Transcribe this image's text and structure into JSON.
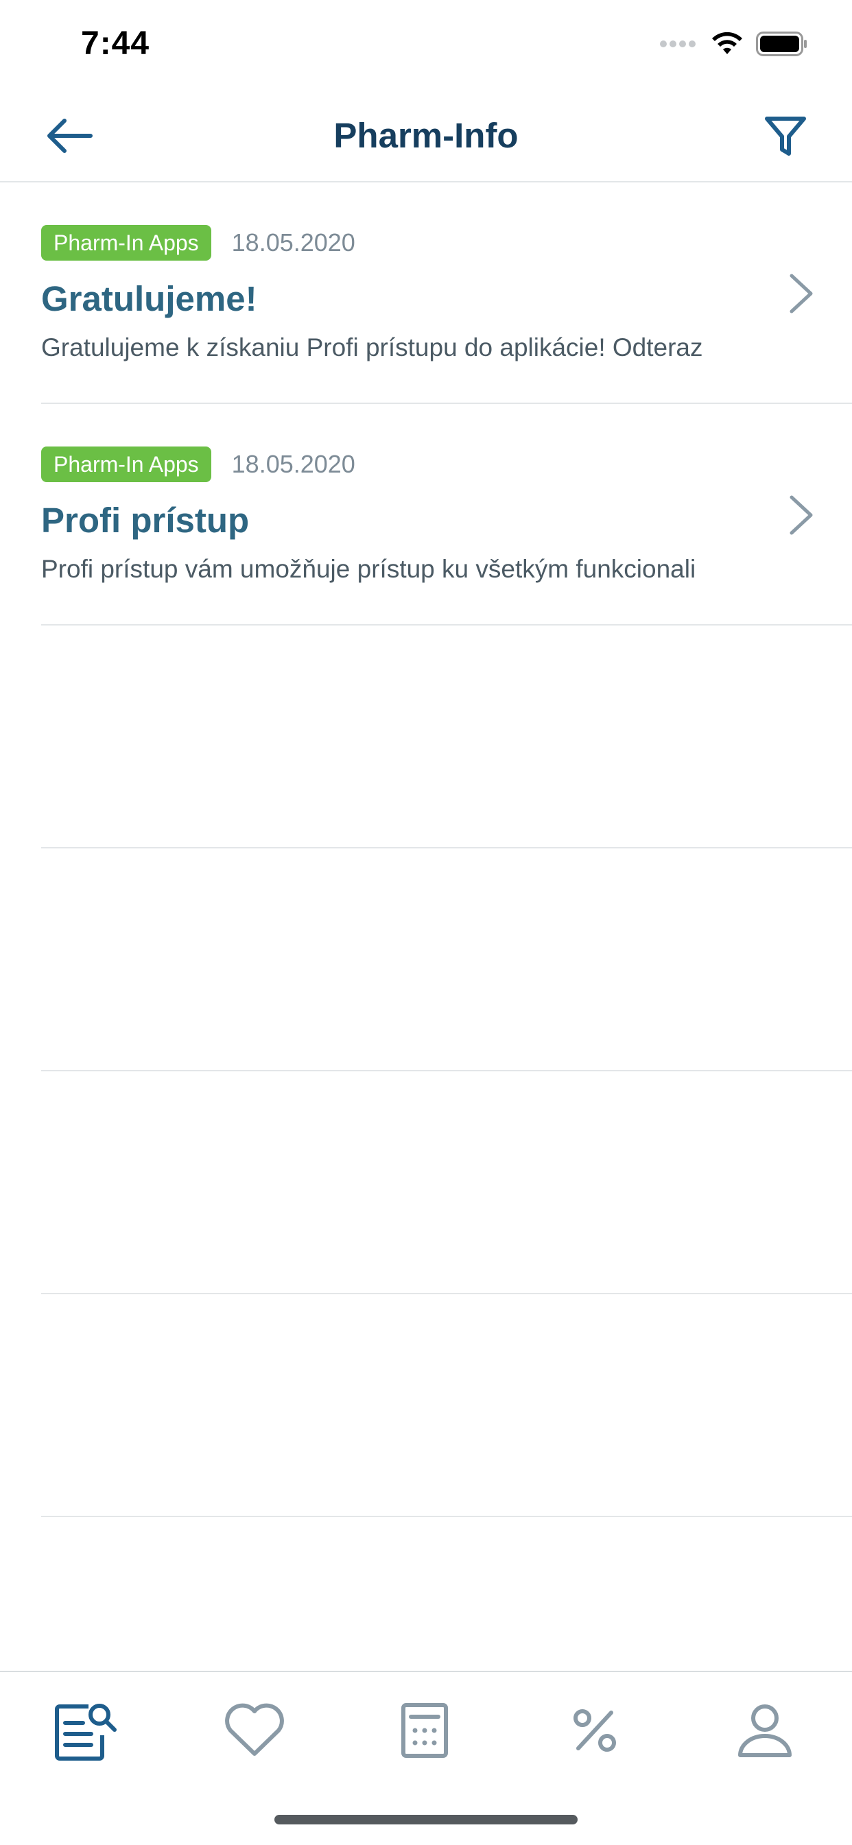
{
  "status_bar": {
    "time": "7:44"
  },
  "nav": {
    "title": "Pharm-Info",
    "back_icon": "arrow-left-icon",
    "filter_icon": "filter-funnel-icon"
  },
  "articles": [
    {
      "badge": "Pharm-In Apps",
      "date": "18.05.2020",
      "title": "Gratulujeme!",
      "description": "Gratulujeme k získaniu Profi prístupu do aplikácie! Odteraz"
    },
    {
      "badge": "Pharm-In Apps",
      "date": "18.05.2020",
      "title": "Profi prístup",
      "description": "Profi prístup vám umožňuje prístup ku všetkým funkcionali"
    }
  ],
  "tabs": [
    {
      "icon": "news-search-icon",
      "active": true
    },
    {
      "icon": "heart-icon",
      "active": false
    },
    {
      "icon": "calculator-icon",
      "active": false
    },
    {
      "icon": "percent-icon",
      "active": false
    },
    {
      "icon": "user-icon",
      "active": false
    }
  ],
  "colors": {
    "accent": "#1e5d8c",
    "badge": "#6bbf45",
    "title": "#2e6682",
    "inactive_icon": "#8a9aa6"
  }
}
